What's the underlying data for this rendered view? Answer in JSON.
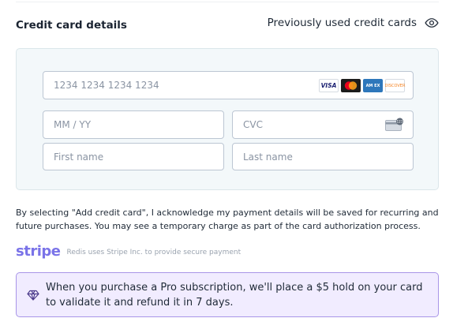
{
  "header": {
    "title": "Credit card details",
    "previous_cards_label": "Previously used credit cards",
    "previous_cards_icon": "eye-icon"
  },
  "card_form": {
    "number_placeholder": "1234 1234 1234 1234",
    "expiry_placeholder": "MM / YY",
    "cvc_placeholder": "CVC",
    "first_name_placeholder": "First name",
    "last_name_placeholder": "Last name",
    "brands": {
      "visa": "VISA",
      "mastercard": "mastercard-logo",
      "amex": "AM EX",
      "discover": "DISCOVER"
    },
    "cvc_icon": "card-back-icon"
  },
  "consent_text": "By selecting \"Add credit card\", I acknowledge my payment details will be saved for recurring and future purchases. You may see a temporary charge as part of the card authorization process.",
  "stripe": {
    "logo_text": "stripe",
    "note": "Redis uses Stripe Inc. to provide secure payment"
  },
  "notice": {
    "icon": "gem-icon",
    "text": "When you purchase a Pro subscription, we'll place a $5 hold on your card to validate it and refund it in 7 days."
  },
  "colors": {
    "panel_bg": "#f3f8fa",
    "notice_bg": "#f1ecff",
    "notice_border": "#a895e8",
    "stripe_brand": "#7a73e8"
  }
}
